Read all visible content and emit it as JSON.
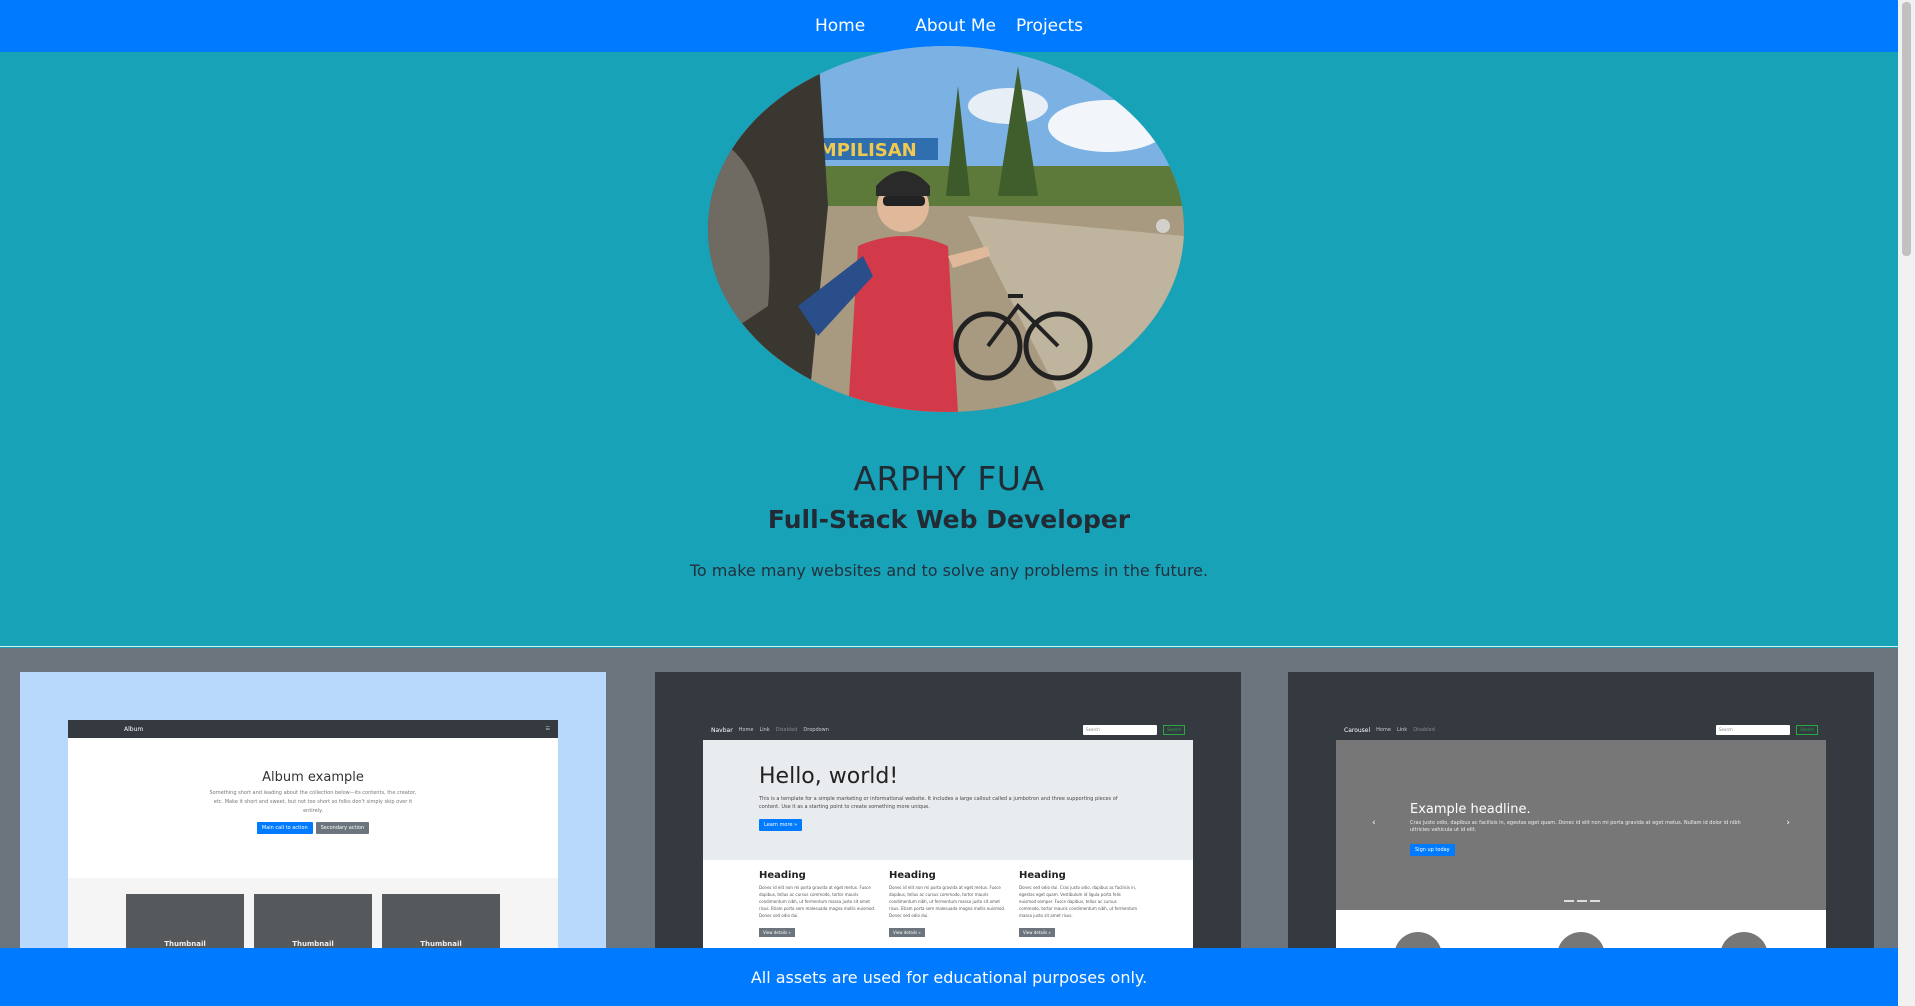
{
  "nav": {
    "items": [
      {
        "label": "Home"
      },
      {
        "label": "About Me"
      },
      {
        "label": "Projects"
      }
    ]
  },
  "hero": {
    "name": "ARPHY FUA",
    "role": "Full-Stack Web Developer",
    "tagline": "To make many websites and to solve any problems in the future.",
    "photo_sign": "TAMPILISAN"
  },
  "projects": {
    "album": {
      "nav_title": "Album",
      "heading": "Album example",
      "text": "Something short and leading about the collection below—its contents, the creator, etc. Make it short and sweet, but not too short so folks don't simply skip over it entirely.",
      "primary_btn": "Main call to action",
      "secondary_btn": "Secondary action",
      "thumbs": [
        "Thumbnail",
        "Thumbnail",
        "Thumbnail"
      ]
    },
    "jumbotron": {
      "nav_brand": "Navbar",
      "nav_links": [
        "Home",
        "Link",
        "Disabled",
        "Dropdown"
      ],
      "search_placeholder": "Search",
      "search_btn": "Search",
      "heading": "Hello, world!",
      "text": "This is a template for a simple marketing or informational website. It includes a large callout called a jumbotron and three supporting pieces of content. Use it as a starting point to create something more unique.",
      "learn_btn": "Learn more »",
      "columns": [
        {
          "heading": "Heading",
          "text": "Donec id elit non mi porta gravida at eget metus. Fusce dapibus, tellus ac cursus commodo, tortor mauris condimentum nibh, ut fermentum massa justo sit amet risus. Etiam porta sem malesuada magna mollis euismod. Donec sed odio dui.",
          "btn": "View details »"
        },
        {
          "heading": "Heading",
          "text": "Donec id elit non mi porta gravida at eget metus. Fusce dapibus, tellus ac cursus commodo, tortor mauris condimentum nibh, ut fermentum massa justo sit amet risus. Etiam porta sem malesuada magna mollis euismod. Donec sed odio dui.",
          "btn": "View details »"
        },
        {
          "heading": "Heading",
          "text": "Donec sed odio dui. Cras justo odio, dapibus ac facilisis in, egestas eget quam. Vestibulum id ligula porta felis euismod semper. Fusce dapibus, tellus ac cursus commodo, tortor mauris condimentum nibh, ut fermentum massa justo sit amet risus.",
          "btn": "View details »"
        }
      ]
    },
    "carousel": {
      "nav_brand": "Carousel",
      "nav_links": [
        "Home",
        "Link",
        "Disabled"
      ],
      "search_placeholder": "Search",
      "search_btn": "Search",
      "heading": "Example headline.",
      "text": "Cras justo odio, dapibus ac facilisis in, egestas eget quam. Donec id elit non mi porta gravida at eget metus. Nullam id dolor id nibh ultricies vehicula ut id elit.",
      "btn": "Sign up today"
    }
  },
  "footer": {
    "text": "All assets are used for educational purposes only."
  },
  "colors": {
    "nav": "#007bff",
    "hero": "#17a2b8",
    "projects": "#6c757d",
    "footer": "#007bff"
  }
}
